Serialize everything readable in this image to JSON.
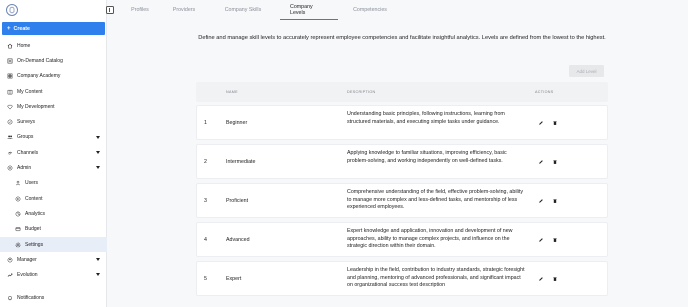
{
  "sidebar": {
    "create_label": "Create",
    "items": [
      {
        "label": "Home",
        "icon": "home-icon"
      },
      {
        "label": "On-Demand Catalog",
        "icon": "catalog-icon"
      },
      {
        "label": "Company Academy",
        "icon": "academy-icon"
      },
      {
        "label": "My Content",
        "icon": "content-icon"
      },
      {
        "label": "My Development",
        "icon": "heart-icon"
      },
      {
        "label": "Surveys",
        "icon": "survey-icon"
      },
      {
        "label": "Groups",
        "icon": "groups-icon"
      },
      {
        "label": "Channels",
        "icon": "channels-icon"
      },
      {
        "label": "Admin",
        "icon": "admin-icon"
      },
      {
        "label": "Users",
        "icon": "users-icon"
      },
      {
        "label": "Content",
        "icon": "content-icon"
      },
      {
        "label": "Analytics",
        "icon": "analytics-icon"
      },
      {
        "label": "Budget",
        "icon": "budget-icon"
      },
      {
        "label": "Settings",
        "icon": "settings-icon"
      },
      {
        "label": "Manager",
        "icon": "manager-icon"
      },
      {
        "label": "Evolution",
        "icon": "evolution-icon"
      }
    ],
    "notifications_label": "Notifications"
  },
  "tabs": [
    {
      "label": "Profiles"
    },
    {
      "label": "Providers"
    },
    {
      "label": "Company Skills"
    },
    {
      "label": "Company Levels"
    },
    {
      "label": "Competencies"
    }
  ],
  "active_tab": "Company Levels",
  "main": {
    "description": "Define and manage skill levels to accurately represent employee competencies and facilitate insightful analytics. Levels are defined from the lowest to the highest.",
    "add_level_label": "Add Level",
    "columns": [
      "NAME",
      "DESCRIPTION",
      "ACTIONS"
    ],
    "rows": [
      {
        "num": "1",
        "name": "Beginner",
        "description": "Understanding basic principles, following instructions, learning from structured materials, and executing simple tasks under guidance."
      },
      {
        "num": "2",
        "name": "Intermediate",
        "description": "Applying knowledge to familiar situations, improving efficiency, basic problem-solving, and working independently on well-defined tasks."
      },
      {
        "num": "3",
        "name": "Proficient",
        "description": "Comprehensive understanding of the field, effective problem-solving, ability to manage more complex and less-defined tasks, and mentorship of less experienced employees."
      },
      {
        "num": "4",
        "name": "Advanced",
        "description": "Expert knowledge and application, innovation and development of new approaches, ability to manage complex projects, and influence on the strategic direction within their domain."
      },
      {
        "num": "5",
        "name": "Expert",
        "description": "Leadership in the field, contribution to industry standards, strategic foresight and planning, mentoring of advanced professionals, and significant impact on organizational success test description"
      }
    ]
  },
  "colors": {
    "accent": "#2f80ed",
    "active_nav_bg": "#e8eef8",
    "disabled_btn_bg": "#e7e8ea"
  }
}
